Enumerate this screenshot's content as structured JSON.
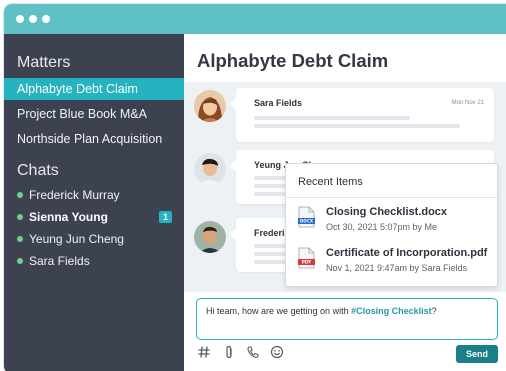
{
  "window": {
    "titlebar_color": "#5fc0c8"
  },
  "sidebar": {
    "matters_title": "Matters",
    "matters": [
      {
        "label": "Alphabyte Debt Claim",
        "active": true
      },
      {
        "label": "Project Blue Book M&A",
        "active": false
      },
      {
        "label": "Northside Plan Acquisition",
        "active": false
      }
    ],
    "chats_title": "Chats",
    "chats": [
      {
        "label": "Frederick Murray",
        "bold": false
      },
      {
        "label": "Sienna Young",
        "bold": true,
        "badge": "1"
      },
      {
        "label": "Yeung Jun Cheng",
        "bold": false
      },
      {
        "label": "Sara Fields",
        "bold": false
      }
    ]
  },
  "main": {
    "title": "Alphabyte Debt Claim",
    "messages": [
      {
        "name": "Sara Fields",
        "date": "Mon Nov 21"
      },
      {
        "name": "Yeung Jun Ch"
      },
      {
        "name": "Frederi"
      }
    ],
    "recent_items": {
      "title": "Recent Items",
      "files": [
        {
          "name": "Closing Checklist.docx",
          "meta": "Oct 30, 2021 5:07pm by Me",
          "type": "DOCX"
        },
        {
          "name": "Certificate of Incorporation.pdf",
          "meta": "Nov 1, 2021 9:47am by Sara Fields",
          "type": "PDF"
        }
      ]
    },
    "composer": {
      "text_prefix": "Hi team, how are we getting on with ",
      "text_tag": "#Closing Checklist",
      "text_suffix": "?"
    },
    "toolbar": {
      "icons": [
        "hash-icon",
        "paperclip-icon",
        "phone-icon",
        "emoji-icon"
      ],
      "send_label": "Send"
    }
  },
  "colors": {
    "accent": "#25b3bf",
    "sidebar_bg": "#3d4250",
    "online": "#6fd08b",
    "send": "#1a7f86",
    "docx": "#2a6bc4",
    "pdf": "#d63b3b"
  }
}
